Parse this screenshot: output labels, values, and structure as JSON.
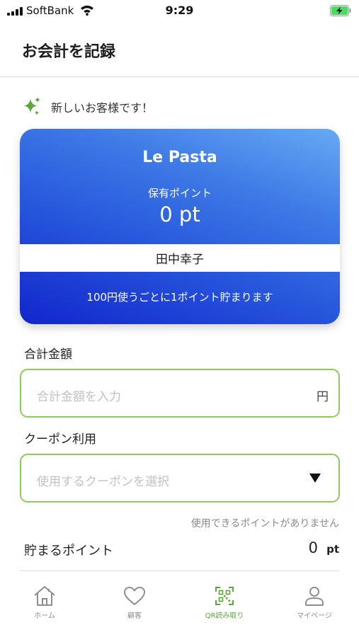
{
  "status_bar": {
    "carrier": "SoftBank",
    "time": "9:29"
  },
  "header": {
    "title": "お会計を記録"
  },
  "notice": {
    "text": "新しいお客様です！",
    "icon": "sparkle-icon"
  },
  "card": {
    "shop_name": "Le Pasta",
    "points_label": "保有ポイント",
    "points_value": "0 pt",
    "member_name": "田中幸子",
    "earn_rule": "100円使うごとに1ポイント貯まります"
  },
  "total_amount": {
    "label": "合計金額",
    "placeholder": "合計金額を入力",
    "value": "",
    "unit": "円"
  },
  "coupon": {
    "label": "クーポン利用",
    "placeholder": "使用するクーポンを選択",
    "selected": ""
  },
  "points_notice": "使用できるポイントがありません",
  "earn_points": {
    "label": "貯まるポイント",
    "value": "0",
    "unit": "pt"
  },
  "tabs": [
    {
      "label": "ホーム",
      "icon": "home-icon",
      "active": false
    },
    {
      "label": "顧客",
      "icon": "heart-icon",
      "active": false
    },
    {
      "label": "QR読み取り",
      "icon": "qr-scan-icon",
      "active": true
    },
    {
      "label": "マイページ",
      "icon": "person-icon",
      "active": false
    }
  ],
  "colors": {
    "accent_green": "#8ccd57",
    "active_tab": "#5aa83a",
    "card_gradient_start": "#66aaf2",
    "card_gradient_end": "#1226cc",
    "battery_green": "#4cd964"
  }
}
